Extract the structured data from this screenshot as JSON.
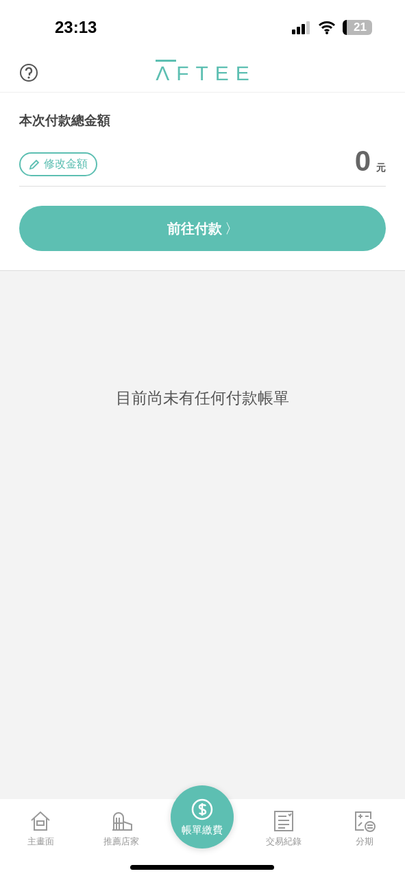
{
  "status_bar": {
    "time": "23:13",
    "battery": "21"
  },
  "header": {
    "logo": "ΛFTEE"
  },
  "payment": {
    "title": "本次付款總金額",
    "edit_button": "修改金額",
    "amount": "0",
    "unit": "元",
    "pay_button": "前往付款",
    "pay_chevron": "〉"
  },
  "empty_message": "目前尚未有任何付款帳單",
  "tabs": [
    {
      "kind": "home",
      "label": "主畫面",
      "selected": false
    },
    {
      "kind": "stores",
      "label": "推薦店家",
      "selected": false
    },
    {
      "kind": "bill",
      "label": "帳單繳費",
      "selected": true
    },
    {
      "kind": "history",
      "label": "交易紀錄",
      "selected": false
    },
    {
      "kind": "installment",
      "label": "分期",
      "selected": false
    }
  ]
}
